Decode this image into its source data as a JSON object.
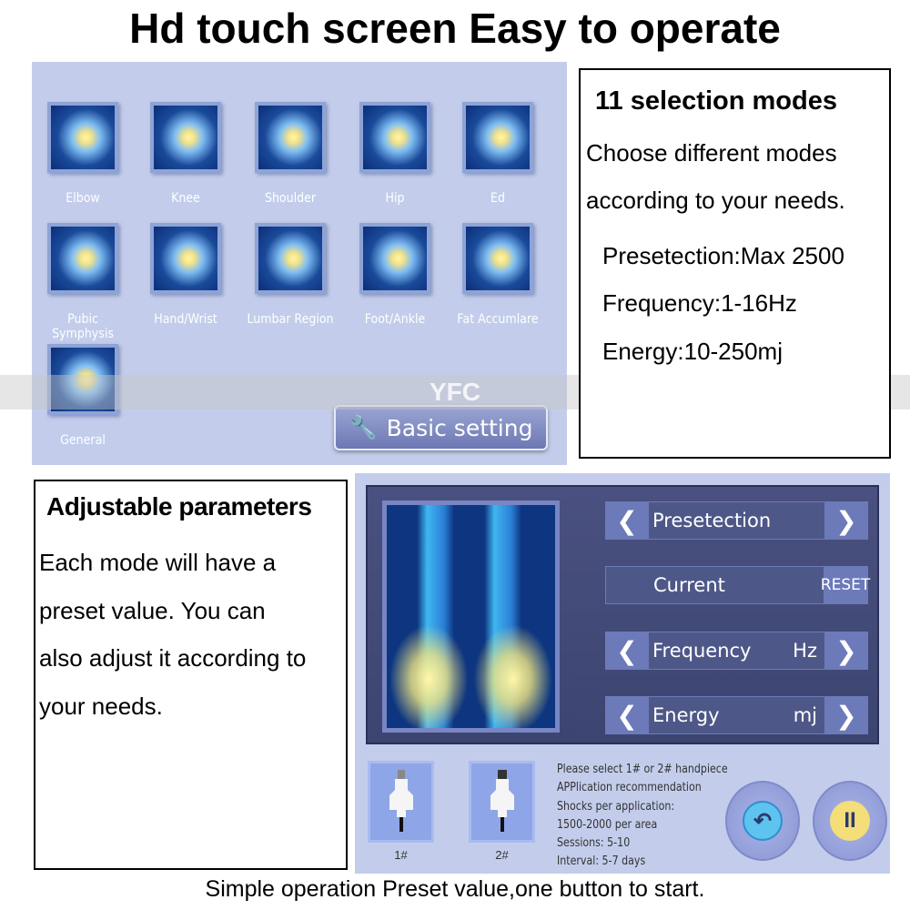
{
  "title": "Hd touch screen  Easy to operate",
  "mode_screen": {
    "modes": [
      {
        "label": "Elbow"
      },
      {
        "label": "Knee"
      },
      {
        "label": "Shoulder"
      },
      {
        "label": "Hip"
      },
      {
        "label": "Ed"
      },
      {
        "label": "Pubic Symphysis"
      },
      {
        "label": "Hand/Wrist"
      },
      {
        "label": "Lumbar Region"
      },
      {
        "label": "Foot/Ankle"
      },
      {
        "label": "Fat Accumlare"
      },
      {
        "label": "General"
      }
    ],
    "basic_setting": "Basic setting",
    "watermark": "YFC"
  },
  "modes_box": {
    "heading": "11 selection modes",
    "line1": "Choose different modes",
    "line2": "according to your needs.",
    "spec1": "Presetection:Max 2500",
    "spec2": "Frequency:1-16Hz",
    "spec3": "Energy:10-250mj"
  },
  "params_box": {
    "heading": "Adjustable parameters",
    "lines": [
      "Each mode will have a",
      "preset value. You can",
      "also adjust it according to",
      "your needs."
    ]
  },
  "param_screen": {
    "presetection": "Presetection",
    "current": "Current",
    "reset": "RESET",
    "frequency": "Frequency",
    "frequency_unit": "Hz",
    "energy": "Energy",
    "energy_unit": "mj",
    "handpiece1": "1#",
    "handpiece2": "2#",
    "info": [
      "Please select 1# or 2# handpiece",
      "APPlication recommendation",
      "Shocks per application:",
      "1500-2000 per area",
      "Sessions: 5-10",
      "Interval: 5-7 days"
    ],
    "accent_play": "#f3de7a",
    "accent_back": "#5fc3f0"
  },
  "footer": "Simple operation Preset value,one button to start."
}
